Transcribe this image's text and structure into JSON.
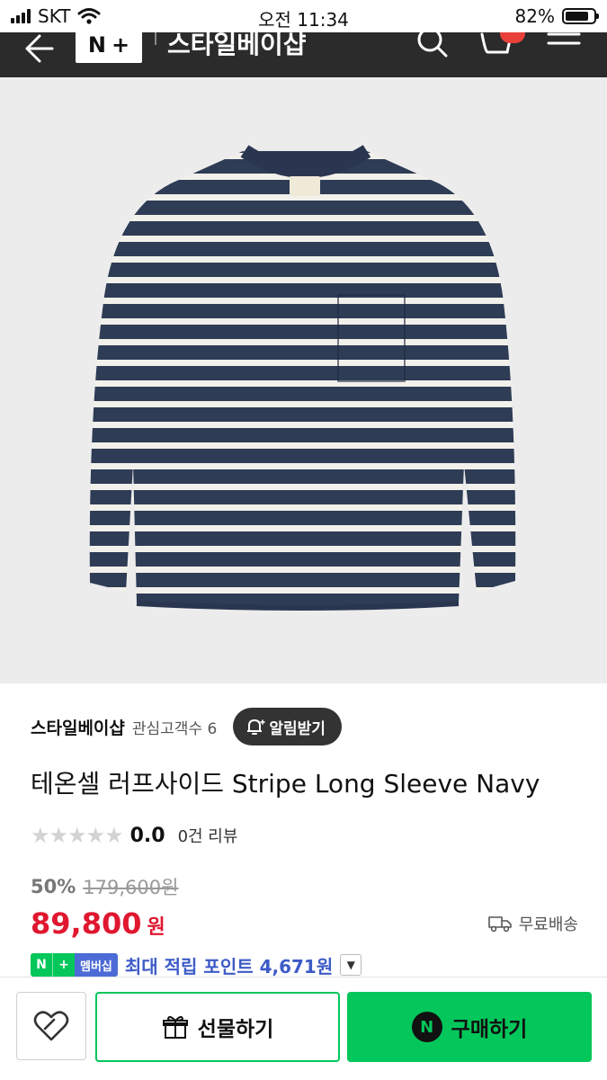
{
  "status_bar": {
    "carrier": "SKT",
    "time": "오전 11:34",
    "battery_percent": "82%",
    "battery_level": 0.82
  },
  "app_bar": {
    "logo_n": "N",
    "logo_plus": "+",
    "title": "스타일베이샵"
  },
  "seller": {
    "name": "스타일베이샵",
    "favorite_label": "관심고객수 6",
    "alarm_label": "알림받기"
  },
  "product": {
    "title": "테온셀 러프사이드 Stripe Long Sleeve Navy",
    "rating": "0.0",
    "rating_stars": 0,
    "review_count": "0건 리뷰",
    "discount_rate": "50%",
    "original_price": "179,600원",
    "price": "89,800",
    "currency": "원",
    "shipping": "무료배송"
  },
  "points": {
    "badge_n": "N",
    "badge_plus": "+",
    "badge_member": "멤버십",
    "text": "최대 적립 포인트 4,671원"
  },
  "bottom_bar": {
    "gift_label": "선물하기",
    "buy_n": "N",
    "buy_label": "구매하기"
  },
  "colors": {
    "app_bar": "#2b2b2b",
    "naver_green": "#03c75a",
    "price_red": "#e0172f",
    "membership_blue": "#3d5bc7"
  },
  "icons": [
    "signal-icon",
    "wifi-icon",
    "battery-icon",
    "back-arrow-icon",
    "search-icon",
    "cart-icon",
    "menu-icon",
    "bell-plus-icon",
    "star-icon",
    "truck-icon",
    "chevron-down-icon",
    "heart-icon",
    "gift-icon"
  ]
}
